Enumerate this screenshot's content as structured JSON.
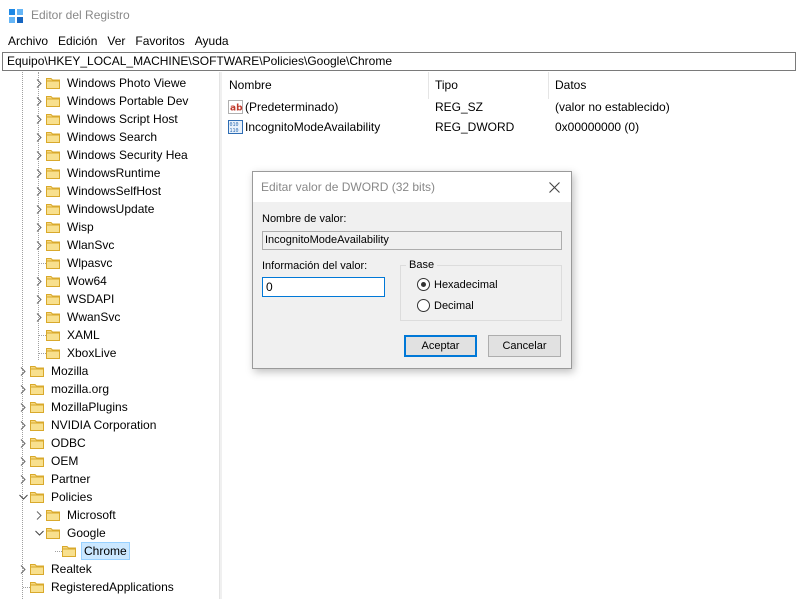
{
  "window": {
    "title": "Editor del Registro"
  },
  "menu": [
    "Archivo",
    "Edición",
    "Ver",
    "Favoritos",
    "Ayuda"
  ],
  "address": "Equipo\\HKEY_LOCAL_MACHINE\\SOFTWARE\\Policies\\Google\\Chrome",
  "tree": {
    "items": [
      {
        "label": "Windows Photo Viewe",
        "level": 2,
        "expander": "›"
      },
      {
        "label": "Windows Portable Dev",
        "level": 2,
        "expander": "›"
      },
      {
        "label": "Windows Script Host",
        "level": 2,
        "expander": "›"
      },
      {
        "label": "Windows Search",
        "level": 2,
        "expander": "›"
      },
      {
        "label": "Windows Security Hea",
        "level": 2,
        "expander": "›"
      },
      {
        "label": "WindowsRuntime",
        "level": 2,
        "expander": "›"
      },
      {
        "label": "WindowsSelfHost",
        "level": 2,
        "expander": "›"
      },
      {
        "label": "WindowsUpdate",
        "level": 2,
        "expander": "›"
      },
      {
        "label": "Wisp",
        "level": 2,
        "expander": "›"
      },
      {
        "label": "WlanSvc",
        "level": 2,
        "expander": "›"
      },
      {
        "label": "Wlpasvc",
        "level": 2,
        "expander": ""
      },
      {
        "label": "Wow64",
        "level": 2,
        "expander": "›"
      },
      {
        "label": "WSDAPI",
        "level": 2,
        "expander": "›"
      },
      {
        "label": "WwanSvc",
        "level": 2,
        "expander": "›"
      },
      {
        "label": "XAML",
        "level": 2,
        "expander": ""
      },
      {
        "label": "XboxLive",
        "level": 2,
        "expander": ""
      },
      {
        "label": "Mozilla",
        "level": 1,
        "expander": "›"
      },
      {
        "label": "mozilla.org",
        "level": 1,
        "expander": "›"
      },
      {
        "label": "MozillaPlugins",
        "level": 1,
        "expander": "›"
      },
      {
        "label": "NVIDIA Corporation",
        "level": 1,
        "expander": "›"
      },
      {
        "label": "ODBC",
        "level": 1,
        "expander": "›"
      },
      {
        "label": "OEM",
        "level": 1,
        "expander": "›"
      },
      {
        "label": "Partner",
        "level": 1,
        "expander": "›"
      },
      {
        "label": "Policies",
        "level": 1,
        "expander": "⌄"
      },
      {
        "label": "Microsoft",
        "level": 2,
        "expander": "›"
      },
      {
        "label": "Google",
        "level": 2,
        "expander": "⌄"
      },
      {
        "label": "Chrome",
        "level": 3,
        "expander": "",
        "selected": true
      },
      {
        "label": "Realtek",
        "level": 1,
        "expander": "›"
      },
      {
        "label": "RegisteredApplications",
        "level": 1,
        "expander": ""
      }
    ]
  },
  "list": {
    "columns": [
      "Nombre",
      "Tipo",
      "Datos"
    ],
    "rows": [
      {
        "name": "(Predeterminado)",
        "type": "REG_SZ",
        "data": "(valor no establecido)",
        "icon": "string-value-icon"
      },
      {
        "name": "IncognitoModeAvailability",
        "type": "REG_DWORD",
        "data": "0x00000000 (0)",
        "icon": "dword-value-icon"
      }
    ]
  },
  "dialog": {
    "title": "Editar valor de DWORD (32 bits)",
    "name_label": "Nombre de valor:",
    "name_value": "IncognitoModeAvailability",
    "data_label": "Información del valor:",
    "data_value": "0",
    "base_label": "Base",
    "radio_hex": "Hexadecimal",
    "radio_dec": "Decimal",
    "selected_base": "Hexadecimal",
    "ok": "Aceptar",
    "cancel": "Cancelar"
  },
  "colors": {
    "folder": "#e8c04d",
    "selection": "#cce8ff",
    "accent": "#0078d7"
  }
}
